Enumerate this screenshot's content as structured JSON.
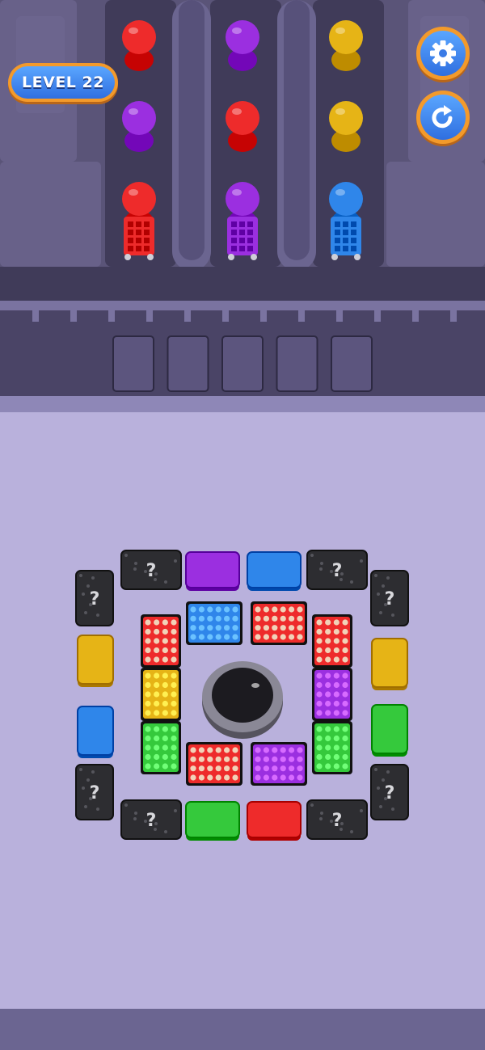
{
  "hud": {
    "level_label": "LEVEL 22",
    "settings_icon": "gear-icon",
    "restart_icon": "restart-icon"
  },
  "colors": {
    "red": "#ee2b2b",
    "purple": "#9b2fe0",
    "yellow": "#e6b416",
    "blue": "#2f86ea",
    "green": "#35c93c",
    "dark_tile": "#2d2d31",
    "board_bg": "#b9b1dc",
    "top_bg": "#5a5478",
    "hud_blue": "#3d86f0",
    "hud_orange": "#f39a2b"
  },
  "queues": [
    {
      "column": 1,
      "people_top_to_bottom": [
        "red",
        "purple",
        "red"
      ],
      "cart": "red"
    },
    {
      "column": 2,
      "people_top_to_bottom": [
        "purple",
        "red",
        "purple"
      ],
      "cart": "purple"
    },
    {
      "column": 3,
      "people_top_to_bottom": [
        "yellow",
        "yellow",
        "blue"
      ],
      "cart": "blue"
    }
  ],
  "holding_slots": {
    "count": 5,
    "filled": 0
  },
  "board": {
    "outer_ring": [
      {
        "id": "top-mystery-left",
        "color": "dark",
        "mystery": true
      },
      {
        "id": "top-purple",
        "color": "purple",
        "mystery": false
      },
      {
        "id": "top-blue",
        "color": "blue",
        "mystery": false
      },
      {
        "id": "top-mystery-right",
        "color": "dark",
        "mystery": true
      },
      {
        "id": "left-mystery-top",
        "color": "dark",
        "mystery": true
      },
      {
        "id": "left-yellow",
        "color": "yellow",
        "mystery": false
      },
      {
        "id": "left-blue",
        "color": "blue",
        "mystery": false
      },
      {
        "id": "left-mystery-bottom",
        "color": "dark",
        "mystery": true
      },
      {
        "id": "right-mystery-top",
        "color": "dark",
        "mystery": true
      },
      {
        "id": "right-yellow",
        "color": "yellow",
        "mystery": false
      },
      {
        "id": "right-green",
        "color": "green",
        "mystery": false
      },
      {
        "id": "right-mystery-bottom",
        "color": "dark",
        "mystery": true
      },
      {
        "id": "bottom-mystery-left",
        "color": "dark",
        "mystery": true
      },
      {
        "id": "bottom-green",
        "color": "green",
        "mystery": false
      },
      {
        "id": "bottom-red",
        "color": "red",
        "mystery": false
      },
      {
        "id": "bottom-mystery-right",
        "color": "dark",
        "mystery": true
      }
    ],
    "inner_ring": [
      {
        "id": "crate-top-blue",
        "color": "blue",
        "content": "pins"
      },
      {
        "id": "crate-top-red",
        "color": "red",
        "content": "pins"
      },
      {
        "id": "crate-left-red",
        "color": "red",
        "content": "pins"
      },
      {
        "id": "crate-left-yellow",
        "color": "yellow",
        "content": "pins"
      },
      {
        "id": "crate-left-green",
        "color": "green",
        "content": "pins"
      },
      {
        "id": "crate-right-red",
        "color": "red",
        "content": "pins"
      },
      {
        "id": "crate-right-purple",
        "color": "purple",
        "content": "pins"
      },
      {
        "id": "crate-right-green",
        "color": "green",
        "content": "pins"
      },
      {
        "id": "crate-bottom-red",
        "color": "red",
        "content": "pins"
      },
      {
        "id": "crate-bottom-purple",
        "color": "purple",
        "content": "pins"
      }
    ],
    "center": {
      "type": "hole"
    }
  }
}
